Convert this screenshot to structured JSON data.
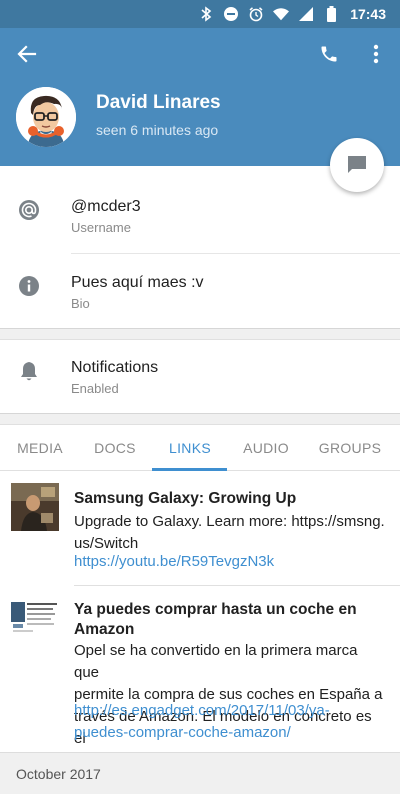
{
  "status_bar": {
    "time": "17:43",
    "icons": [
      "bluetooth-icon",
      "do-not-disturb-icon",
      "alarm-icon",
      "wifi-icon",
      "signal-icon",
      "battery-icon"
    ]
  },
  "colors": {
    "header": "#4a8bbd",
    "status_bar": "#3f78a0",
    "accent": "#3f8fd0"
  },
  "toolbar": {
    "back_icon": "arrow-back-icon",
    "call_icon": "phone-icon",
    "more_icon": "more-vert-icon"
  },
  "profile": {
    "name": "David Linares",
    "status": "seen 6 minutes ago",
    "avatar_icon": "avatar-cartoon"
  },
  "fab_icon": "message-icon",
  "info": {
    "username": {
      "value": "@mcder3",
      "label": "Username",
      "icon": "at-icon"
    },
    "bio": {
      "value": "Pues aquí maes :v",
      "label": "Bio",
      "icon": "info-icon"
    },
    "notifications": {
      "value": "Notifications",
      "label": "Enabled",
      "icon": "bell-icon"
    }
  },
  "tabs": [
    {
      "label": "MEDIA",
      "active": false
    },
    {
      "label": "DOCS",
      "active": false
    },
    {
      "label": "LINKS",
      "active": true
    },
    {
      "label": "AUDIO",
      "active": false
    },
    {
      "label": "GROUPS",
      "active": false
    }
  ],
  "links": [
    {
      "title": "Samsung Galaxy: Growing Up",
      "description": [
        "Upgrade to Galaxy. Learn more: https://smsng.",
        "us/Switch"
      ],
      "url": "https://youtu.be/R59TevgzN3k"
    },
    {
      "title": [
        "Ya puedes comprar hasta un coche en",
        "Amazon"
      ],
      "description": [
        "Opel se ha convertido en la primera marca que",
        "permite la compra de sus coches en España a",
        "través de Amazon. El modelo en concreto es el"
      ],
      "url": [
        "http://es.engadget.com/2017/11/03/ya-",
        "puedes-comprar-coche-amazon/"
      ]
    }
  ],
  "date_header": "October 2017"
}
